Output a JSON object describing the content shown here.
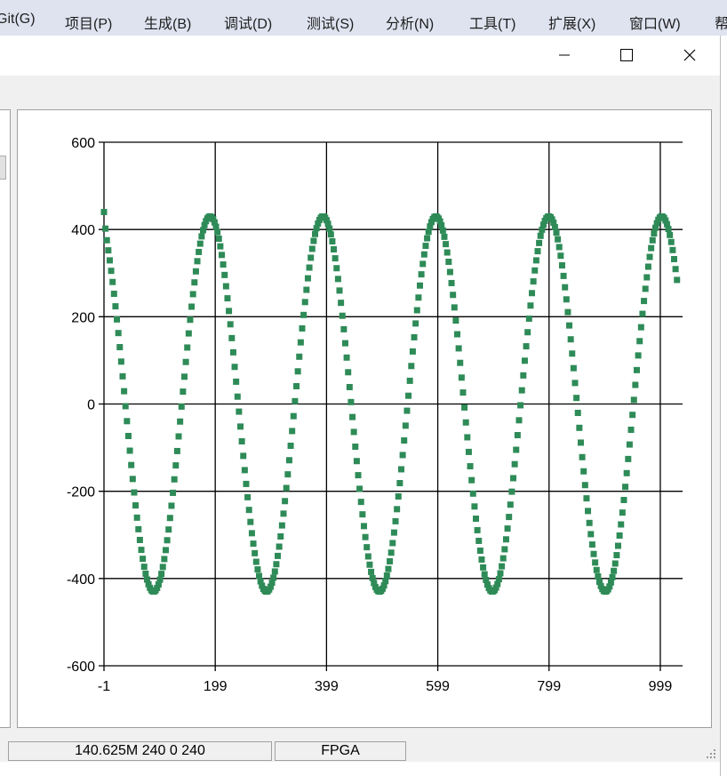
{
  "menubar": {
    "items": [
      "Git(G)",
      "项目(P)",
      "生成(B)",
      "调试(D)",
      "测试(S)",
      "分析(N)",
      "工具(T)",
      "扩展(X)",
      "窗口(W)",
      "帮"
    ]
  },
  "window": {
    "minimize_glyph": "—",
    "maximize_glyph": "☐",
    "close_glyph": "✕"
  },
  "status": {
    "left": "140.625M 240 0 240",
    "right": "FPGA"
  },
  "chart_data": {
    "type": "scatter",
    "title": "",
    "xlabel": "",
    "ylabel": "",
    "xlim": [
      -1,
      1039
    ],
    "ylim": [
      -600,
      600
    ],
    "x_ticks": [
      -1,
      199,
      399,
      599,
      799,
      999
    ],
    "y_ticks": [
      600,
      400,
      200,
      0,
      -200,
      -400,
      -600
    ],
    "grid": true,
    "legend": "none",
    "series": [
      {
        "color": "#2e8b57",
        "marker": "square",
        "points": 400,
        "amplitude": 430,
        "x_start": -1,
        "x_end": 1029,
        "period_x": 203,
        "phase_deg": 22,
        "y_start": 440
      }
    ]
  }
}
